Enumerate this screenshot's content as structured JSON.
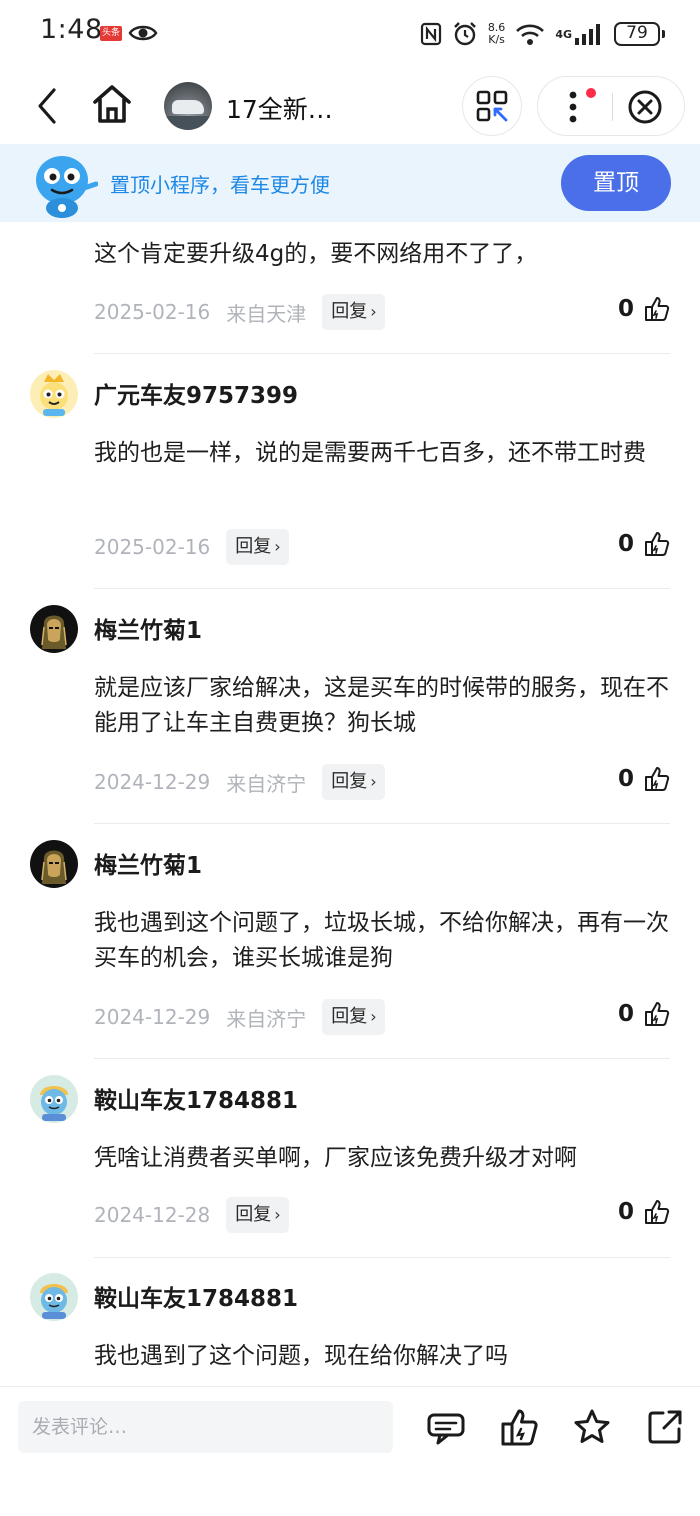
{
  "status_bar": {
    "time": "1:48",
    "news_badge": "头条",
    "net_speed_value": "8.6",
    "net_speed_unit": "K/s",
    "network": "4G",
    "battery": "79"
  },
  "nav": {
    "title": "17全新…"
  },
  "banner": {
    "text": "置顶小程序，看车更方便",
    "button": "置顶"
  },
  "comments": [
    {
      "user": "",
      "text": "这个肯定要升级4g的，要不网络用不了了，",
      "date": "2025-02-16",
      "location": "来自天津",
      "reply": "回复",
      "likes": "0"
    },
    {
      "user": "广元车友9757399",
      "text": "我的也是一样，说的是需要两千七百多，还不带工时费",
      "date": "2025-02-16",
      "location": "",
      "reply": "回复",
      "likes": "0"
    },
    {
      "user": "梅兰竹菊1",
      "text": "就是应该厂家给解决，这是买车的时候带的服务，现在不能用了让车主自费更换？狗长城",
      "date": "2024-12-29",
      "location": "来自济宁",
      "reply": "回复",
      "likes": "0"
    },
    {
      "user": "梅兰竹菊1",
      "text": "我也遇到这个问题了，垃圾长城，不给你解决，再有一次买车的机会，谁买长城谁是狗",
      "date": "2024-12-29",
      "location": "来自济宁",
      "reply": "回复",
      "likes": "0"
    },
    {
      "user": "鞍山车友1784881",
      "text": "凭啥让消费者买单啊，厂家应该免费升级才对啊",
      "date": "2024-12-28",
      "location": "",
      "reply": "回复",
      "likes": "0"
    },
    {
      "user": "鞍山车友1784881",
      "text": "我也遇到了这个问题，现在给你解决了吗",
      "date": "",
      "location": "",
      "reply": "",
      "likes": ""
    }
  ],
  "bottom_bar": {
    "comment_placeholder": "发表评论…"
  },
  "colors": {
    "accent_blue": "#4a6fe8",
    "banner_bg": "#e9f4fd",
    "banner_text": "#1e88e5",
    "badge_red": "#ff2b4a"
  }
}
